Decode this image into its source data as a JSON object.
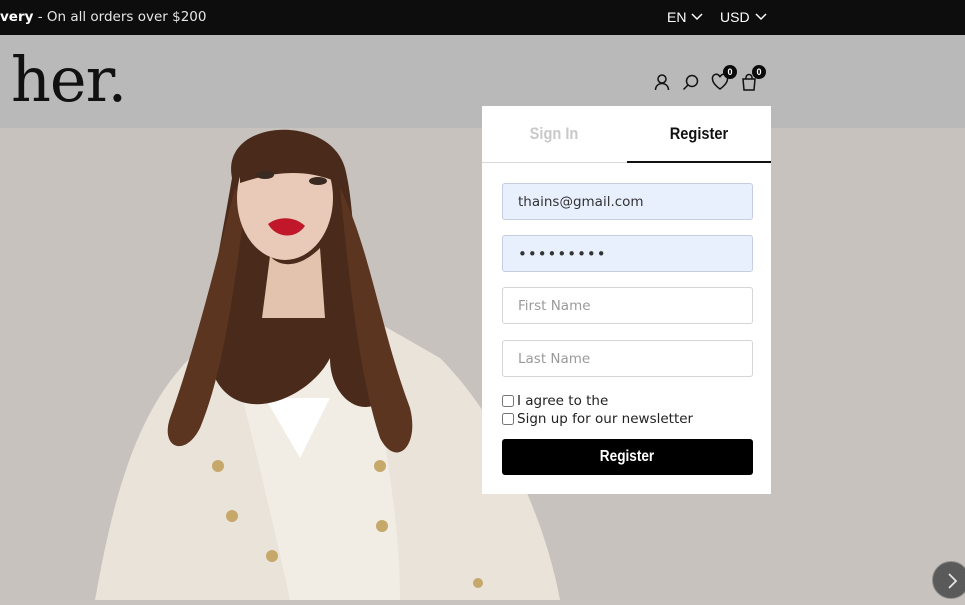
{
  "topbar": {
    "promo_bold": "very",
    "promo_text": " - On all orders over $200",
    "language": "EN",
    "currency": "USD"
  },
  "header": {
    "logo": "her.",
    "icons": [
      "user-icon",
      "search-icon",
      "heart-icon",
      "bag-icon"
    ],
    "wishlist_count": "0",
    "cart_count": "0"
  },
  "auth": {
    "tabs": [
      {
        "label": "Sign In",
        "active": false
      },
      {
        "label": "Register",
        "active": true
      }
    ],
    "email_value": "thains@gmail.com",
    "password_value": "•••••••••",
    "first_name_placeholder": "First Name",
    "last_name_placeholder": "Last Name",
    "agree_label": "I agree to the",
    "newsletter_label": "Sign up for our newsletter",
    "submit_label": "Register"
  },
  "colors": {
    "topbar_bg": "#0d0d0d",
    "header_bg": "#b9b9b9",
    "hero_bg": "#c8c2be",
    "button_bg": "#000000",
    "autofill_bg": "#e8f0fe"
  }
}
